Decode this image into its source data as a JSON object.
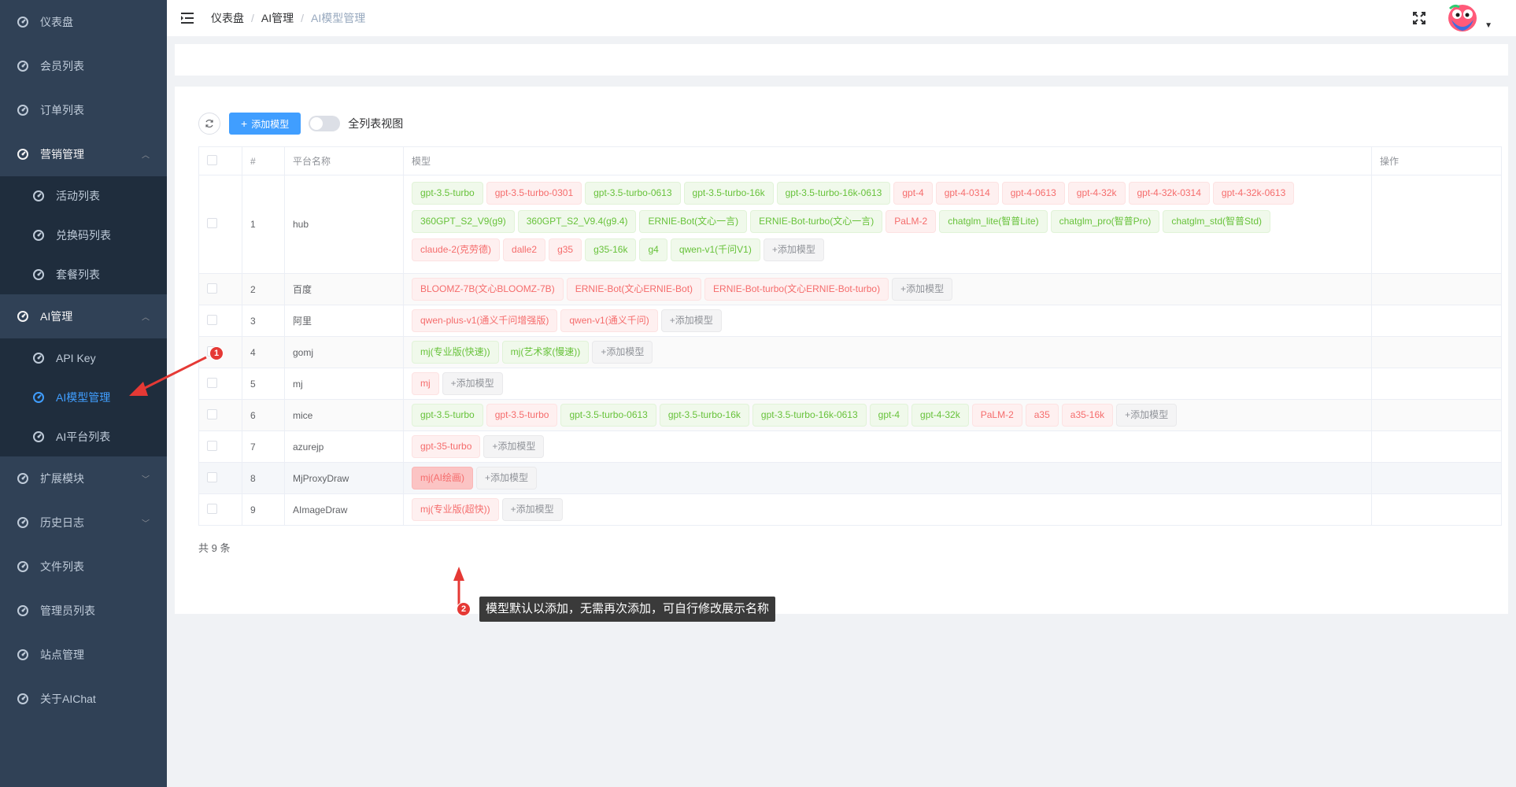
{
  "sidebar": {
    "items": [
      {
        "label": "仪表盘"
      },
      {
        "label": "会员列表"
      },
      {
        "label": "订单列表"
      },
      {
        "label": "营销管理",
        "children": [
          "活动列表",
          "兑换码列表",
          "套餐列表"
        ]
      },
      {
        "label": "AI管理",
        "children": [
          "API Key",
          "AI模型管理",
          "AI平台列表"
        ]
      },
      {
        "label": "扩展模块"
      },
      {
        "label": "历史日志"
      },
      {
        "label": "文件列表"
      },
      {
        "label": "管理员列表"
      },
      {
        "label": "站点管理"
      },
      {
        "label": "关于AIChat"
      }
    ],
    "active": "AI模型管理",
    "colors": {
      "bg": "#304156",
      "sub_bg": "#1f2d3d",
      "active": "#409eff"
    }
  },
  "breadcrumb": [
    "仪表盘",
    "AI管理",
    "AI模型管理"
  ],
  "toolbar": {
    "add_label": "添加模型",
    "switch_label": "全列表视图"
  },
  "table": {
    "headers": {
      "index": "#",
      "platform": "平台名称",
      "models": "模型",
      "actions": "操作"
    },
    "rows": [
      {
        "index": "1",
        "platform": "hub",
        "models": [
          {
            "t": "gpt-3.5-turbo",
            "c": "green"
          },
          {
            "t": "gpt-3.5-turbo-0301",
            "c": "red"
          },
          {
            "t": "gpt-3.5-turbo-0613",
            "c": "green"
          },
          {
            "t": "gpt-3.5-turbo-16k",
            "c": "green"
          },
          {
            "t": "gpt-3.5-turbo-16k-0613",
            "c": "green"
          },
          {
            "t": "gpt-4",
            "c": "red"
          },
          {
            "t": "gpt-4-0314",
            "c": "red"
          },
          {
            "t": "gpt-4-0613",
            "c": "red"
          },
          {
            "t": "gpt-4-32k",
            "c": "red"
          },
          {
            "t": "gpt-4-32k-0314",
            "c": "red"
          },
          {
            "t": "gpt-4-32k-0613",
            "c": "red"
          },
          {
            "t": "360GPT_S2_V9(g9)",
            "c": "green"
          },
          {
            "t": "360GPT_S2_V9.4(g9.4)",
            "c": "green"
          },
          {
            "t": "ERNIE-Bot(文心一言)",
            "c": "green"
          },
          {
            "t": "ERNIE-Bot-turbo(文心一言)",
            "c": "green"
          },
          {
            "t": "PaLM-2",
            "c": "red"
          },
          {
            "t": "chatglm_lite(智普Lite)",
            "c": "green"
          },
          {
            "t": "chatglm_pro(智普Pro)",
            "c": "green"
          },
          {
            "t": "chatglm_std(智普Std)",
            "c": "green"
          },
          {
            "t": "claude-2(克劳德)",
            "c": "red"
          },
          {
            "t": "dalle2",
            "c": "red"
          },
          {
            "t": "g35",
            "c": "red"
          },
          {
            "t": "g35-16k",
            "c": "green"
          },
          {
            "t": "g4",
            "c": "green"
          },
          {
            "t": "qwen-v1(千问V1)",
            "c": "green"
          },
          {
            "t": "+添加模型",
            "c": "add"
          }
        ],
        "breaks": [
          11,
          19
        ]
      },
      {
        "index": "2",
        "platform": "百度",
        "models": [
          {
            "t": "BLOOMZ-7B(文心BLOOMZ-7B)",
            "c": "red"
          },
          {
            "t": "ERNIE-Bot(文心ERNIE-Bot)",
            "c": "red"
          },
          {
            "t": "ERNIE-Bot-turbo(文心ERNIE-Bot-turbo)",
            "c": "red"
          },
          {
            "t": "+添加模型",
            "c": "add"
          }
        ]
      },
      {
        "index": "3",
        "platform": "阿里",
        "models": [
          {
            "t": "qwen-plus-v1(通义千问增强版)",
            "c": "red"
          },
          {
            "t": "qwen-v1(通义千问)",
            "c": "red"
          },
          {
            "t": "+添加模型",
            "c": "add"
          }
        ]
      },
      {
        "index": "4",
        "platform": "gomj",
        "models": [
          {
            "t": "mj(专业版(快速))",
            "c": "green"
          },
          {
            "t": "mj(艺术家(慢速))",
            "c": "green"
          },
          {
            "t": "+添加模型",
            "c": "add"
          }
        ]
      },
      {
        "index": "5",
        "platform": "mj",
        "models": [
          {
            "t": "mj",
            "c": "red"
          },
          {
            "t": "+添加模型",
            "c": "add"
          }
        ]
      },
      {
        "index": "6",
        "platform": "mice",
        "models": [
          {
            "t": "gpt-3.5-turbo",
            "c": "green"
          },
          {
            "t": "gpt-3.5-turbo",
            "c": "red"
          },
          {
            "t": "gpt-3.5-turbo-0613",
            "c": "green"
          },
          {
            "t": "gpt-3.5-turbo-16k",
            "c": "green"
          },
          {
            "t": "gpt-3.5-turbo-16k-0613",
            "c": "green"
          },
          {
            "t": "gpt-4",
            "c": "green"
          },
          {
            "t": "gpt-4-32k",
            "c": "green"
          },
          {
            "t": "PaLM-2",
            "c": "red"
          },
          {
            "t": "a35",
            "c": "red"
          },
          {
            "t": "a35-16k",
            "c": "red"
          },
          {
            "t": "+添加模型",
            "c": "add"
          }
        ]
      },
      {
        "index": "7",
        "platform": "azurejp",
        "models": [
          {
            "t": "gpt-35-turbo",
            "c": "red"
          },
          {
            "t": "+添加模型",
            "c": "add"
          }
        ]
      },
      {
        "index": "8",
        "platform": "MjProxyDraw",
        "models": [
          {
            "t": "mj(AI绘画)",
            "c": "red-dark"
          },
          {
            "t": "+添加模型",
            "c": "add"
          }
        ]
      },
      {
        "index": "9",
        "platform": "AImageDraw",
        "models": [
          {
            "t": "mj(专业版(超快))",
            "c": "red"
          },
          {
            "t": "+添加模型",
            "c": "add"
          }
        ]
      }
    ],
    "total": "共 9 条"
  },
  "annotations": {
    "badge1": "1",
    "badge2": "2",
    "tip": "模型默认以添加，无需再次添加，可自行修改展示名称",
    "color": "#e53935"
  }
}
